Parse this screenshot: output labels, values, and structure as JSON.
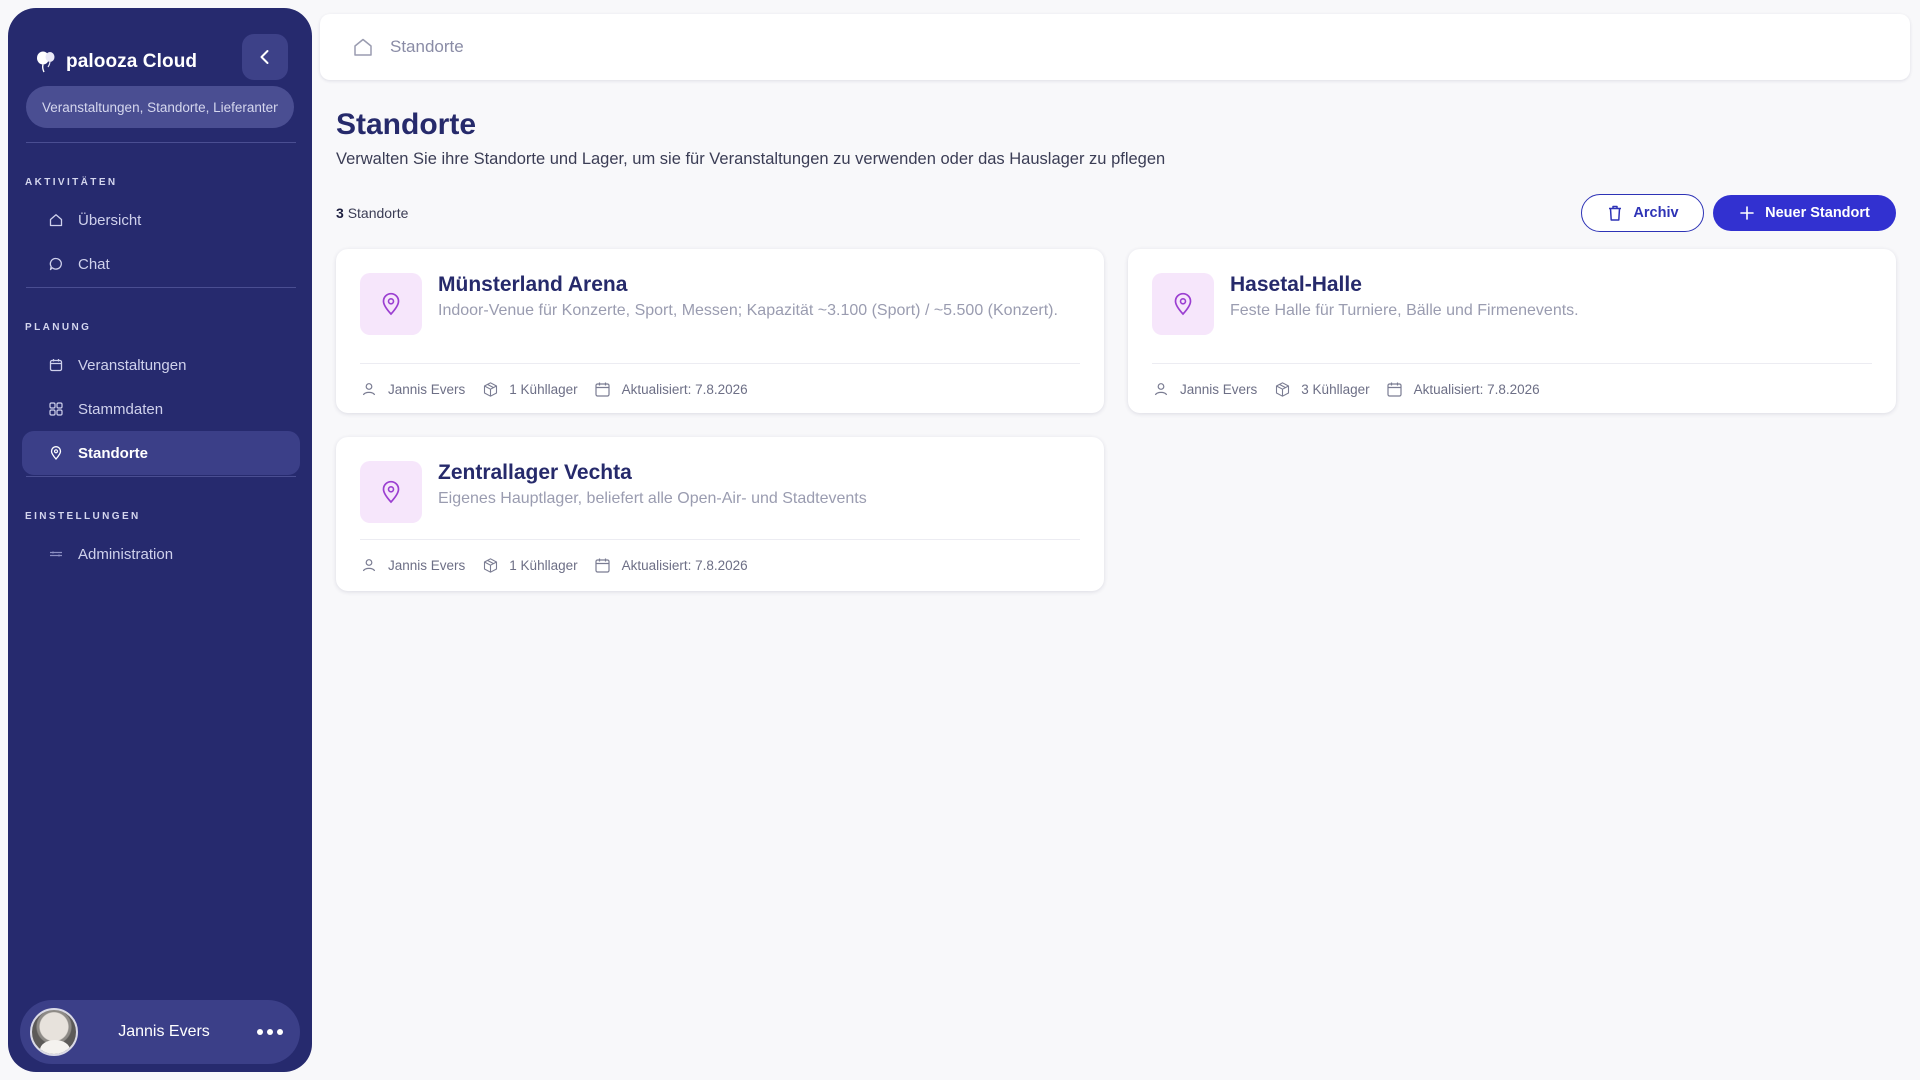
{
  "sidebar": {
    "brand": "palooza Cloud",
    "search_placeholder": "Veranstaltungen, Standorte, Lieferanten",
    "sections": [
      {
        "title": "AKTIVITÄTEN",
        "items": [
          {
            "label": "Übersicht",
            "icon": "home-icon"
          },
          {
            "label": "Chat",
            "icon": "chat-bubble-icon"
          }
        ]
      },
      {
        "title": "PLANUNG",
        "items": [
          {
            "label": "Veranstaltungen",
            "icon": "calendar-icon"
          },
          {
            "label": "Stammdaten",
            "icon": "grid-icon"
          },
          {
            "label": "Standorte",
            "icon": "map-pin-icon",
            "active": true
          }
        ]
      },
      {
        "title": "EINSTELLUNGEN",
        "items": [
          {
            "label": "Administration",
            "icon": "sliders-icon"
          }
        ]
      }
    ],
    "user": {
      "name": "Jannis Evers"
    }
  },
  "topbar": {
    "breadcrumb": "Standorte"
  },
  "main": {
    "title": "Standorte",
    "subtitle": "Verwalten Sie ihre Standorte und Lager, um sie für Veranstaltungen zu verwenden oder das Hauslager zu pflegen",
    "count_number": "3",
    "count_label": "Standorte",
    "archive_label": "Archiv",
    "new_label": "Neuer Standort",
    "cards": [
      {
        "title": "Münsterland Arena",
        "description": "Indoor-Venue für Konzerte, Sport, Messen; Kapazität ~3.100 (Sport) / ~5.500 (Konzert).",
        "owner": "Jannis Evers",
        "storage": "1 Kühllager",
        "updated": "Aktualisiert: 7.8.2026"
      },
      {
        "title": "Hasetal-Halle",
        "description": "Feste Halle für Turniere, Bälle und Firmenevents.",
        "owner": "Jannis Evers",
        "storage": "3 Kühllager",
        "updated": "Aktualisiert: 7.8.2026"
      },
      {
        "title": "Zentrallager Vechta",
        "description": "Eigenes Hauptlager, beliefert alle Open-Air- und Stadtevents",
        "owner": "Jannis Evers",
        "storage": "1 Kühllager",
        "updated": "Aktualisiert: 7.8.2026"
      }
    ]
  },
  "colors": {
    "sidebar_bg": "#262a6e",
    "primary": "#3231d0",
    "title": "#262a6b",
    "pin_accent": "#9b3fd1",
    "card_icon_bg": "#f6e6fb"
  }
}
